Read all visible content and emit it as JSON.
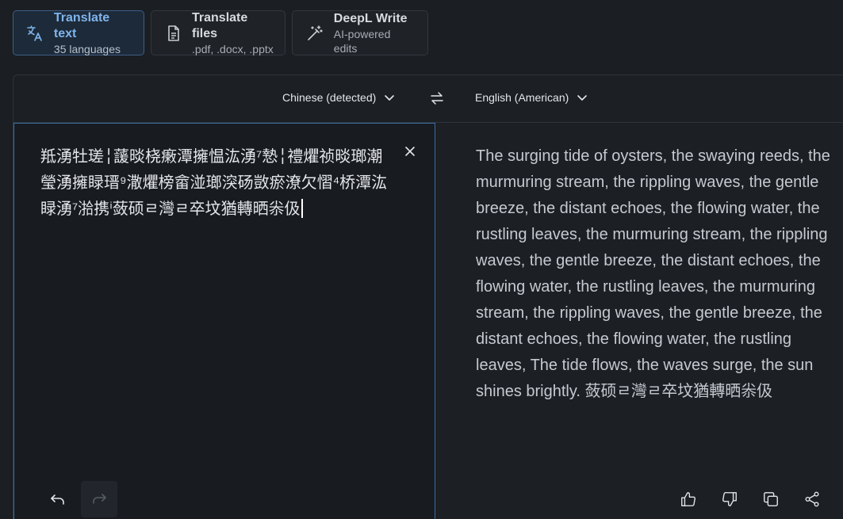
{
  "modes": {
    "text": {
      "title": "Translate text",
      "sub": "35 languages"
    },
    "files": {
      "title": "Translate files",
      "sub": ".pdf, .docx, .pptx"
    },
    "write": {
      "title": "DeepL Write",
      "sub": "AI-powered edits"
    }
  },
  "languages": {
    "source": "Chinese (detected)",
    "target": "English (American)"
  },
  "source": {
    "text": "羝湧牡瑳╎蘐晱桡瘷潭擁愠汯湧⁷慹╎禮爠祯晱瑯潮瑩湧擁睩瑨⁹潵爠榜畲湴瑯湥砀敳瘀潦欠慴⁴桥潭汯睩湧⁷湁携ⁱ蔹硕ㄹ灣ㄹ卒坟猶轉晒尜伋"
  },
  "target": {
    "text": "The surging tide of oysters, the swaying reeds, the murmuring stream, the rippling waves, the gentle breeze, the distant echoes, the flowing water, the rustling leaves, the murmuring stream, the rippling waves, the gentle breeze, the distant echoes, the flowing water, the rustling leaves, the murmuring stream, the rippling waves, the gentle breeze, the distant echoes, the flowing water, the rustling leaves, The tide flows, the waves surge, the sun shines brightly. 蔹硕ㄹ灣ㄹ卒坟猶轉晒尜伋"
  },
  "colors": {
    "accent": "#7fb4ec",
    "active_border": "#3a6ea5",
    "background": "#1b1e23"
  }
}
